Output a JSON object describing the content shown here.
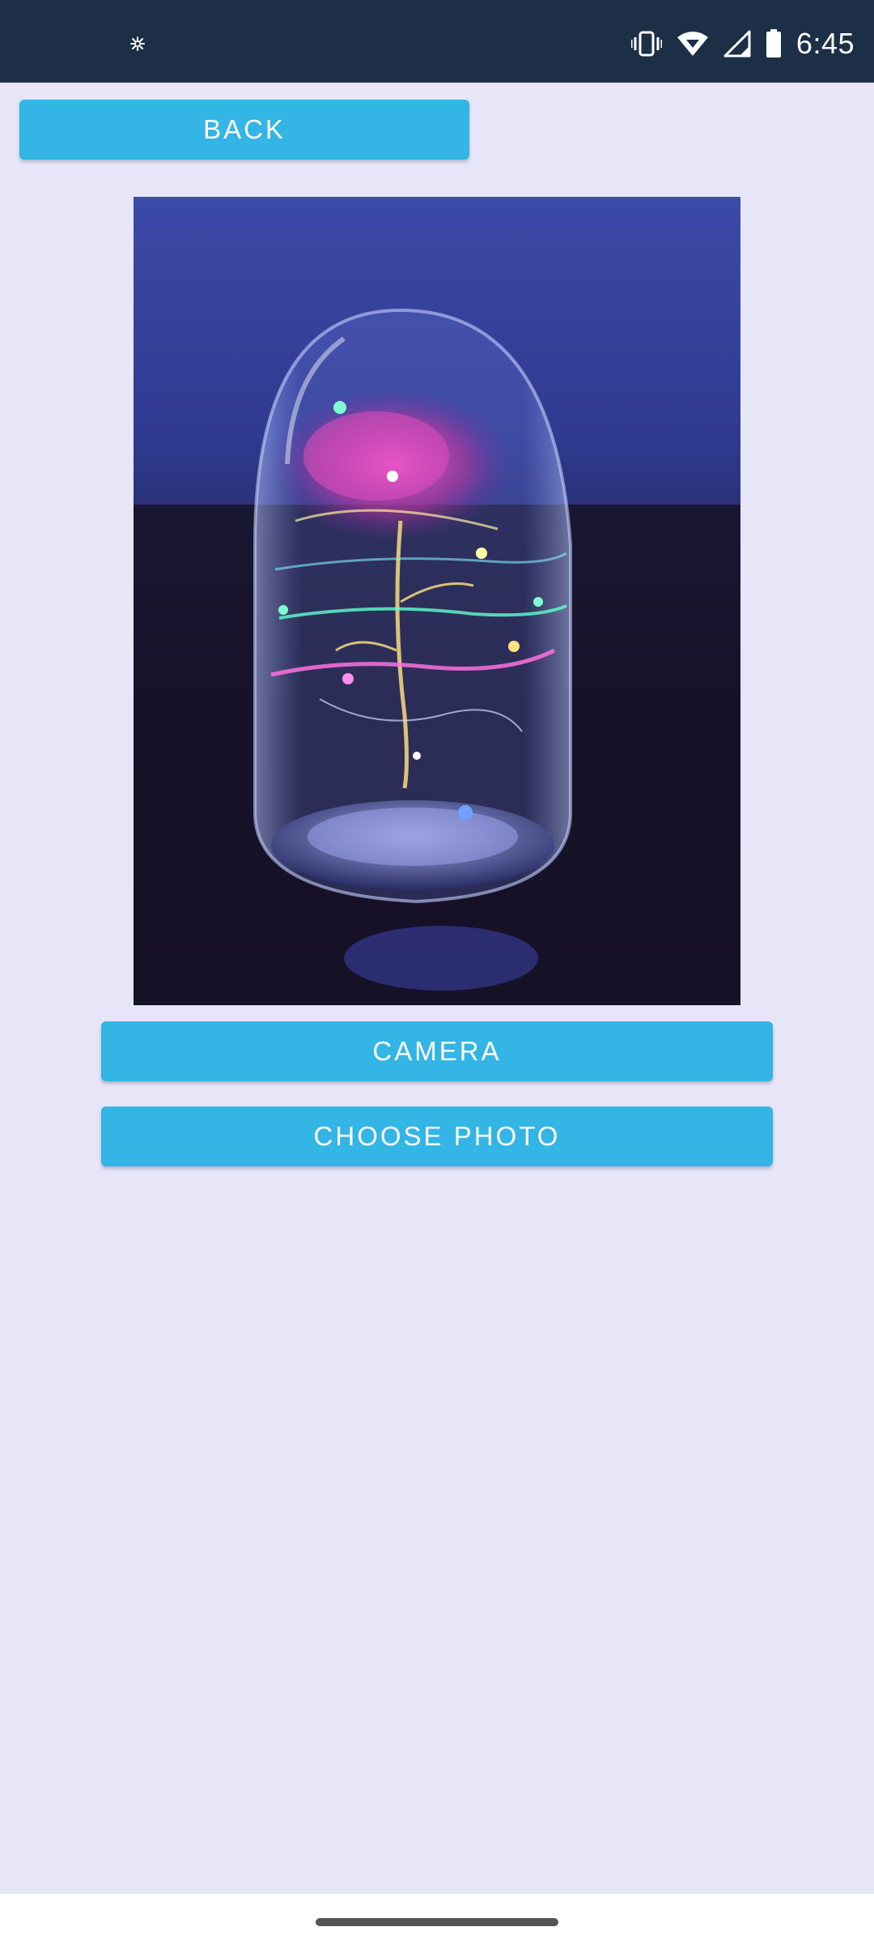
{
  "status_bar": {
    "time": "6:45",
    "left_icon": "sparkle-icon",
    "right_icons": [
      "vibrate-icon",
      "wifi-icon",
      "signal-icon",
      "battery-icon"
    ]
  },
  "buttons": {
    "back_label": "BACK",
    "camera_label": "CAMERA",
    "choose_photo_label": "CHOOSE PHOTO"
  },
  "photo": {
    "subject": "glass-dome-rose-led-lamp"
  },
  "colors": {
    "status_bar_bg": "#1c2f47",
    "page_bg": "#e6e6f8",
    "button_bg": "#33b5e5",
    "button_text": "#ffffff"
  }
}
